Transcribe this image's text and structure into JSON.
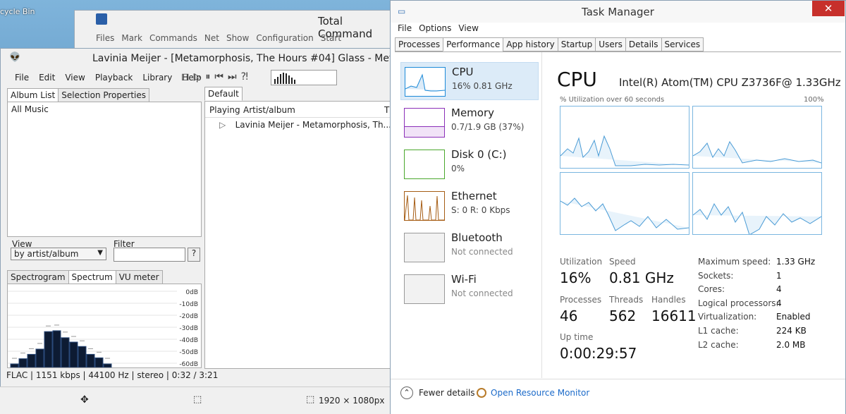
{
  "desktop": {
    "recycle_label": "cycle Bin"
  },
  "total_commander": {
    "title": "Total Command",
    "menu": [
      "Files",
      "Mark",
      "Commands",
      "Net",
      "Show",
      "Configuration",
      "Start"
    ]
  },
  "foobar": {
    "title": "Lavinia Meijer - [Metamorphosis, The Hours #04] Glass - Metam",
    "menu": [
      "File",
      "Edit",
      "View",
      "Playback",
      "Library",
      "Help"
    ],
    "album_tabs": [
      "Album List",
      "Selection Properties"
    ],
    "album_root": "All Music",
    "view_label": "View",
    "view_value": "by artist/album",
    "filter_label": "Filter",
    "help_button": "?",
    "vis_tabs": [
      "Spectrogram",
      "Spectrum",
      "VU meter"
    ],
    "db_labels": [
      "0dB",
      "-10dB",
      "-20dB",
      "-30dB",
      "-40dB",
      "-50dB",
      "-60dB"
    ],
    "spectrum_levels": [
      0.08,
      0.2,
      0.3,
      0.42,
      0.82,
      0.84,
      0.68,
      0.58,
      0.48,
      0.3,
      0.22,
      0.08
    ],
    "playlist_tab": "Default",
    "playlist_headers": [
      "Playing",
      "Artist/album",
      "T"
    ],
    "playlist_row": "Lavinia Meijer - Metamorphosis, Th...",
    "status": "FLAC | 1151 kbps | 44100 Hz | stereo | 0:32 / 3:21",
    "screen_size": "1920 × 1080px"
  },
  "task_manager": {
    "title": "Task Manager",
    "close": "✕",
    "menu": [
      "File",
      "Options",
      "View"
    ],
    "tabs": [
      "Processes",
      "Performance",
      "App history",
      "Startup",
      "Users",
      "Details",
      "Services"
    ],
    "resources": [
      {
        "name": "CPU",
        "sub": "16%  0.81 GHz",
        "color": "#1c8ad8"
      },
      {
        "name": "Memory",
        "sub": "0.7/1.9 GB (37%)",
        "color": "#8b2fb8"
      },
      {
        "name": "Disk 0 (C:)",
        "sub": "0%",
        "color": "#4aa82c"
      },
      {
        "name": "Ethernet",
        "sub": "S: 0  R: 0 Kbps",
        "color": "#a65d14"
      },
      {
        "name": "Bluetooth",
        "sub": "Not connected",
        "color": "#999999"
      },
      {
        "name": "Wi-Fi",
        "sub": "Not connected",
        "color": "#999999"
      }
    ],
    "cpu_heading": "CPU",
    "cpu_model": "Intel(R) Atom(TM) CPU Z3736F@ 1.33GHz",
    "util_label": "% Utilization over 60 seconds",
    "util_max": "100%",
    "stats": {
      "utilization_label": "Utilization",
      "utilization": "16%",
      "speed_label": "Speed",
      "speed": "0.81 GHz",
      "processes_label": "Processes",
      "processes": "46",
      "threads_label": "Threads",
      "threads": "562",
      "handles_label": "Handles",
      "handles": "16611",
      "uptime_label": "Up time",
      "uptime": "0:00:29:57"
    },
    "details": [
      {
        "k": "Maximum speed:",
        "v": "1.33 GHz"
      },
      {
        "k": "Sockets:",
        "v": "1"
      },
      {
        "k": "Cores:",
        "v": "4"
      },
      {
        "k": "Logical processors:",
        "v": "4"
      },
      {
        "k": "Virtualization:",
        "v": "Enabled"
      },
      {
        "k": "L1 cache:",
        "v": "224 KB"
      },
      {
        "k": "L2 cache:",
        "v": "2.0 MB"
      }
    ],
    "fewer_details": "Fewer details",
    "resource_monitor": "Open Resource Monitor",
    "graph_color": "#7ab6e0"
  }
}
